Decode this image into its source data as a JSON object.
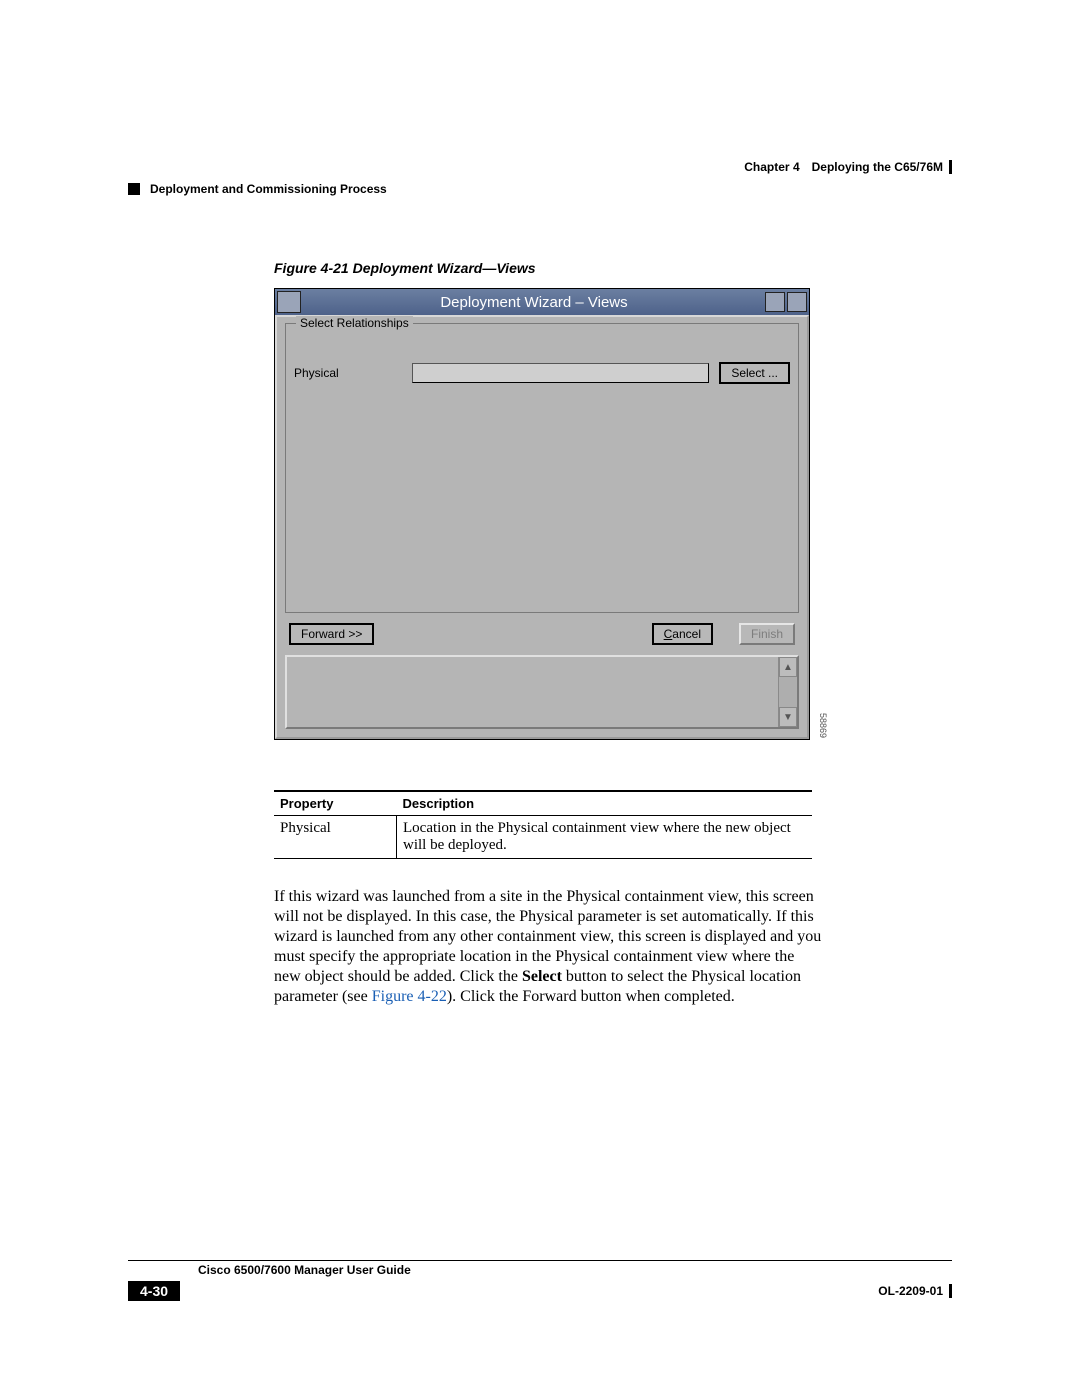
{
  "header": {
    "chapter": "Chapter 4",
    "chapter_title": "Deploying the C65/76M",
    "section": "Deployment and Commissioning Process"
  },
  "figure": {
    "caption": "Figure 4-21   Deployment Wizard—Views",
    "image_id": "58869"
  },
  "wizard": {
    "title": "Deployment Wizard – Views",
    "group_label": "Select Relationships",
    "row_label": "Physical",
    "input_value": "",
    "select_btn": "Select ...",
    "forward_btn": "Forward >>",
    "cancel_btn_pre": "C",
    "cancel_btn_post": "ancel",
    "finish_btn": "Finish"
  },
  "table": {
    "head_property": "Property",
    "head_description": "Description",
    "row1_prop": "Physical",
    "row1_desc": "Location in the Physical containment view where the new object will be deployed."
  },
  "paragraph": {
    "p1": "If this wizard was launched from a site in the Physical containment view, this screen will not be displayed. In this case, the Physical parameter is set automatically. If this wizard is launched from any other containment view, this screen is displayed and you must specify the appropriate location in the Physical containment view where the new object should be added. Click the ",
    "bold1": "Select",
    "p2": " button to select the Physical location parameter (see ",
    "xref": "Figure 4-22",
    "p3": "). Click the Forward button when completed."
  },
  "footer": {
    "guide": "Cisco 6500/7600 Manager User Guide",
    "page": "4-30",
    "docid": "OL-2209-01"
  }
}
